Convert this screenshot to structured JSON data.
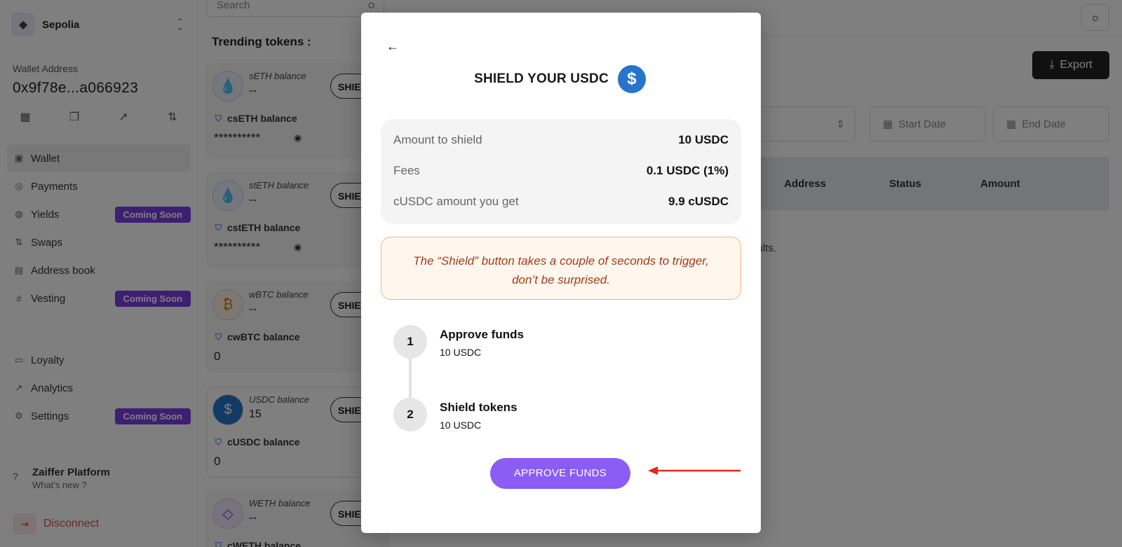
{
  "sidebar": {
    "network": "Sepolia",
    "wallet_label": "Wallet Address",
    "wallet_address": "0x9f78e...a066923",
    "nav": [
      {
        "label": "Wallet",
        "icon": "wallet-icon",
        "badge": ""
      },
      {
        "label": "Payments",
        "icon": "globe-icon",
        "badge": ""
      },
      {
        "label": "Yields",
        "icon": "coins-icon",
        "badge": "Coming Soon"
      },
      {
        "label": "Swaps",
        "icon": "swap-icon",
        "badge": ""
      },
      {
        "label": "Address book",
        "icon": "book-icon",
        "badge": ""
      },
      {
        "label": "Vesting",
        "icon": "hash-icon",
        "badge": "Coming Soon"
      }
    ],
    "nav2": [
      {
        "label": "Loyalty",
        "icon": "ticket-icon",
        "badge": ""
      },
      {
        "label": "Analytics",
        "icon": "chart-icon",
        "badge": ""
      },
      {
        "label": "Settings",
        "icon": "gear-icon",
        "badge": "Coming Soon"
      }
    ],
    "help_title": "Zaiffer Platform",
    "help_sub": "What's new ?",
    "disconnect": "Disconnect"
  },
  "tokens": {
    "search_placeholder": "Search",
    "title": "Trending tokens :",
    "cards": [
      {
        "balance_label": "sETH balance",
        "balance": "--",
        "conf_label": "csETH balance",
        "conf_value": "**********",
        "btn": "SHIE"
      },
      {
        "balance_label": "stETH balance",
        "balance": "--",
        "conf_label": "cstETH balance",
        "conf_value": "**********",
        "btn": "SHIE"
      },
      {
        "balance_label": "wBTC balance",
        "balance": "--",
        "conf_label": "cwBTC balance",
        "conf_value": "0",
        "btn": "SHIE"
      },
      {
        "balance_label": "USDC balance",
        "balance": "15",
        "conf_label": "cUSDC balance",
        "conf_value": "0",
        "btn": "SHIE"
      },
      {
        "balance_label": "WETH balance",
        "balance": "--",
        "conf_label": "cWETH balance",
        "conf_value": "",
        "btn": "SHIE"
      }
    ]
  },
  "main": {
    "export": "Export",
    "start_date": "Start Date",
    "end_date": "End Date",
    "columns": [
      "Address",
      "Status",
      "Amount"
    ],
    "no_results": "sults."
  },
  "modal": {
    "title": "SHIELD YOUR USDC",
    "rows": [
      {
        "key": "Amount to shield",
        "value": "10 USDC"
      },
      {
        "key": "Fees",
        "value": "0.1 USDC (1%)"
      },
      {
        "key": "cUSDC amount you get",
        "value": "9.9 cUSDC"
      }
    ],
    "warning_line1": "The “Shield” button takes a couple of seconds to trigger,",
    "warning_line2": "don’t be surprised.",
    "steps": [
      {
        "num": "1",
        "title": "Approve funds",
        "sub": "10 USDC"
      },
      {
        "num": "2",
        "title": "Shield tokens",
        "sub": "10 USDC"
      }
    ],
    "approve_button": "APPROVE FUNDS"
  },
  "colors": {
    "accent": "#8b5cf6",
    "badge": "#7b3fe4",
    "warning_text": "#a33a1b",
    "arrow": "#e5281b",
    "usdc": "#2775ca"
  }
}
